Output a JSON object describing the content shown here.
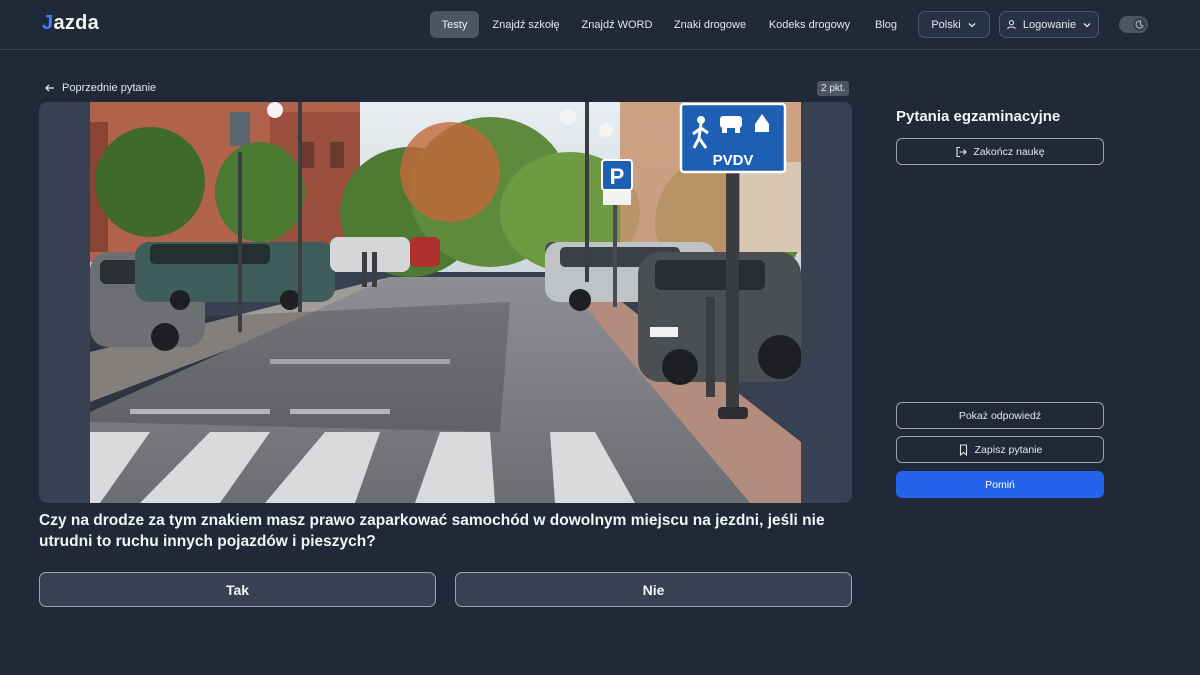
{
  "brand": {
    "logo_text": "azda",
    "logo_prefix": "J"
  },
  "nav": {
    "items": [
      {
        "label": "Testy"
      },
      {
        "label": "Znajdź szkołę"
      },
      {
        "label": "Znajdź WORD"
      },
      {
        "label": "Znaki drogowe"
      },
      {
        "label": "Kodeks drogowy"
      },
      {
        "label": "Blog"
      }
    ],
    "language": "Polski",
    "login": "Logowanie"
  },
  "question_view": {
    "prev_label": "Poprzednie pytanie",
    "points_badge": "2 pkt.",
    "question_text": "Czy na drodze za tym znakiem masz prawo zaparkować samochód w dowolnym miejscu na jezdni, jeśli nie utrudni to ruchu innych pojazdów i pieszych?",
    "answers": [
      {
        "label": "Tak"
      },
      {
        "label": "Nie"
      }
    ],
    "sign_text": "PVDV",
    "parking_sign": "P"
  },
  "side_panel": {
    "title": "Pytania egzaminacyjne",
    "finish_label": "Zakończ naukę",
    "show_answer_label": "Pokaż odpowiedź",
    "save_label": "Zapisz pytanie",
    "skip_label": "Pomiń"
  },
  "colors": {
    "accent": "#2563eb",
    "background": "#1f2937",
    "active_nav": "#4b5563"
  }
}
